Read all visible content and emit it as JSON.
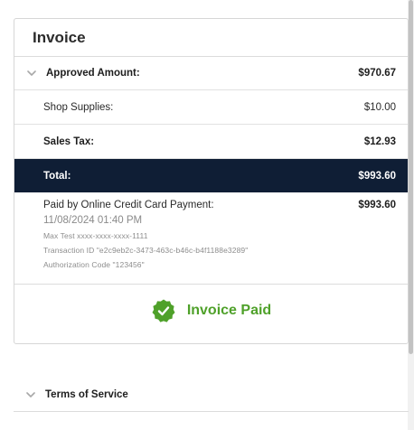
{
  "invoice": {
    "title": "Invoice",
    "approved_label": "Approved Amount:",
    "approved_value": "$970.67",
    "lines": [
      {
        "label": "Shop Supplies:",
        "value": "$10.00"
      },
      {
        "label": "Sales Tax:",
        "value": "$12.93"
      }
    ],
    "total_label": "Total:",
    "total_value": "$993.60"
  },
  "payment": {
    "method_label": "Paid by Online Credit Card Payment:",
    "amount": "$993.60",
    "datetime": "11/08/2024 01:40 PM",
    "card": "Max Test xxxx-xxxx-xxxx-1111",
    "transaction": "Transaction ID \"e2c9eb2c-3473-463c-b46c-b4f1188e3289\"",
    "authorization": "Authorization Code \"123456\""
  },
  "status": {
    "text": "Invoice Paid",
    "color": "#4fa12a",
    "icon": "check-badge-icon"
  },
  "footer": {
    "terms_label": "Terms of Service"
  },
  "colors": {
    "total_bg": "#0f1e35",
    "paid_green": "#4fa12a"
  }
}
